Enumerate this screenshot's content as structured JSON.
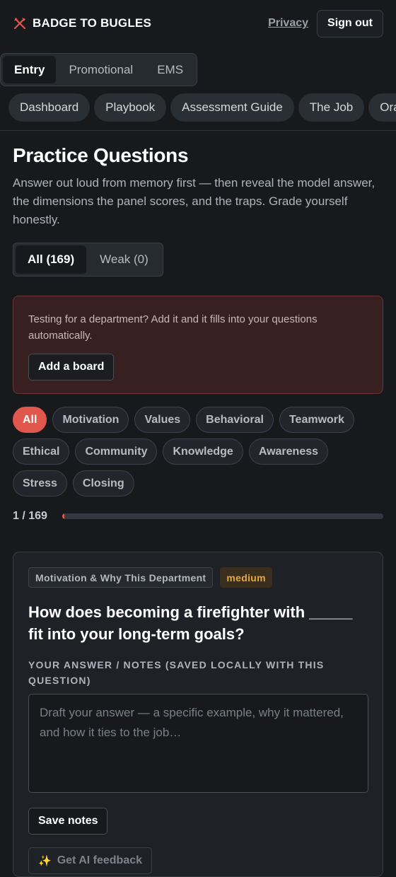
{
  "brand": {
    "name": "BADGE TO BUGLES",
    "icon": "crossed-axes-icon",
    "accent": "#e0574e"
  },
  "header": {
    "privacy": "Privacy",
    "sign_out": "Sign out"
  },
  "tracks": [
    "Entry",
    "Promotional",
    "EMS"
  ],
  "nav": [
    "Dashboard",
    "Playbook",
    "Assessment Guide",
    "The Job",
    "Oral"
  ],
  "main": {
    "title": "Practice Questions",
    "description": "Answer out loud from memory first — then reveal the model answer, the dimensions the panel scores, and the traps. Grade yourself honestly.",
    "filters": [
      "All (169)",
      "Weak (0)"
    ],
    "board": {
      "text": "Testing for a department? Add it and it fills into your questions automatically.",
      "button": "Add a board"
    },
    "categories": [
      "All",
      "Motivation",
      "Values",
      "Behavioral",
      "Teamwork",
      "Ethical",
      "Community",
      "Knowledge",
      "Awareness",
      "Stress",
      "Closing"
    ],
    "progress": {
      "label": "1 / 169",
      "current": 1,
      "total": 169
    }
  },
  "question": {
    "category": "Motivation & Why This Department",
    "difficulty": "medium",
    "text": "How does becoming a firefighter with _____ fit into your long-term goals?",
    "answer_label": "Your answer / notes (saved locally with this question)",
    "placeholder": "Draft your answer — a specific example, why it mattered, and how it ties to the job…",
    "save": "Save notes",
    "ai_feedback": "Get AI feedback",
    "ai_icon": "sparkle-icon"
  }
}
